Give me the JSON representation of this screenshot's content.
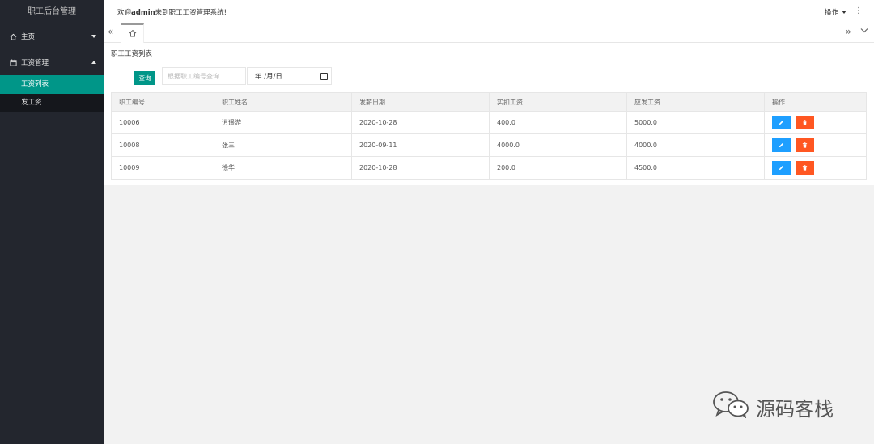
{
  "app": {
    "title": "职工后台管理"
  },
  "sidebar": {
    "items": [
      {
        "label": "主页",
        "icon": "home-icon",
        "expanded": false
      },
      {
        "label": "工资管理",
        "icon": "calendar-icon",
        "expanded": true,
        "children": [
          {
            "label": "工资列表",
            "active": true
          },
          {
            "label": "发工资",
            "active": false
          }
        ]
      }
    ]
  },
  "header": {
    "welcome_pre": "欢迎",
    "user": "admin",
    "welcome_post": "来到职工工资管理系统!",
    "ops_label": "操作",
    "more": "⋮"
  },
  "tabs": {
    "left_arrow": "«",
    "right_arrow": "»",
    "home_icon": "home-icon"
  },
  "page": {
    "title": "职工工资列表",
    "query_button": "查询",
    "search_placeholder": "根据职工编号查询",
    "date_placeholder": "年 /月/日"
  },
  "table": {
    "columns": [
      "职工编号",
      "职工姓名",
      "发薪日期",
      "实扣工资",
      "应发工资",
      "操作"
    ],
    "rows": [
      [
        "10006",
        "逍遥游",
        "2020-10-28",
        "400.0",
        "5000.0"
      ],
      [
        "10008",
        "张三",
        "2020-09-11",
        "4000.0",
        "4000.0"
      ],
      [
        "10009",
        "徐华",
        "2020-10-28",
        "200.0",
        "4500.0"
      ]
    ]
  },
  "watermark": {
    "text": "源码客栈"
  },
  "colors": {
    "sidebar": "#23262e",
    "accent": "#009688",
    "edit": "#1e9fff",
    "delete": "#ff5722"
  }
}
